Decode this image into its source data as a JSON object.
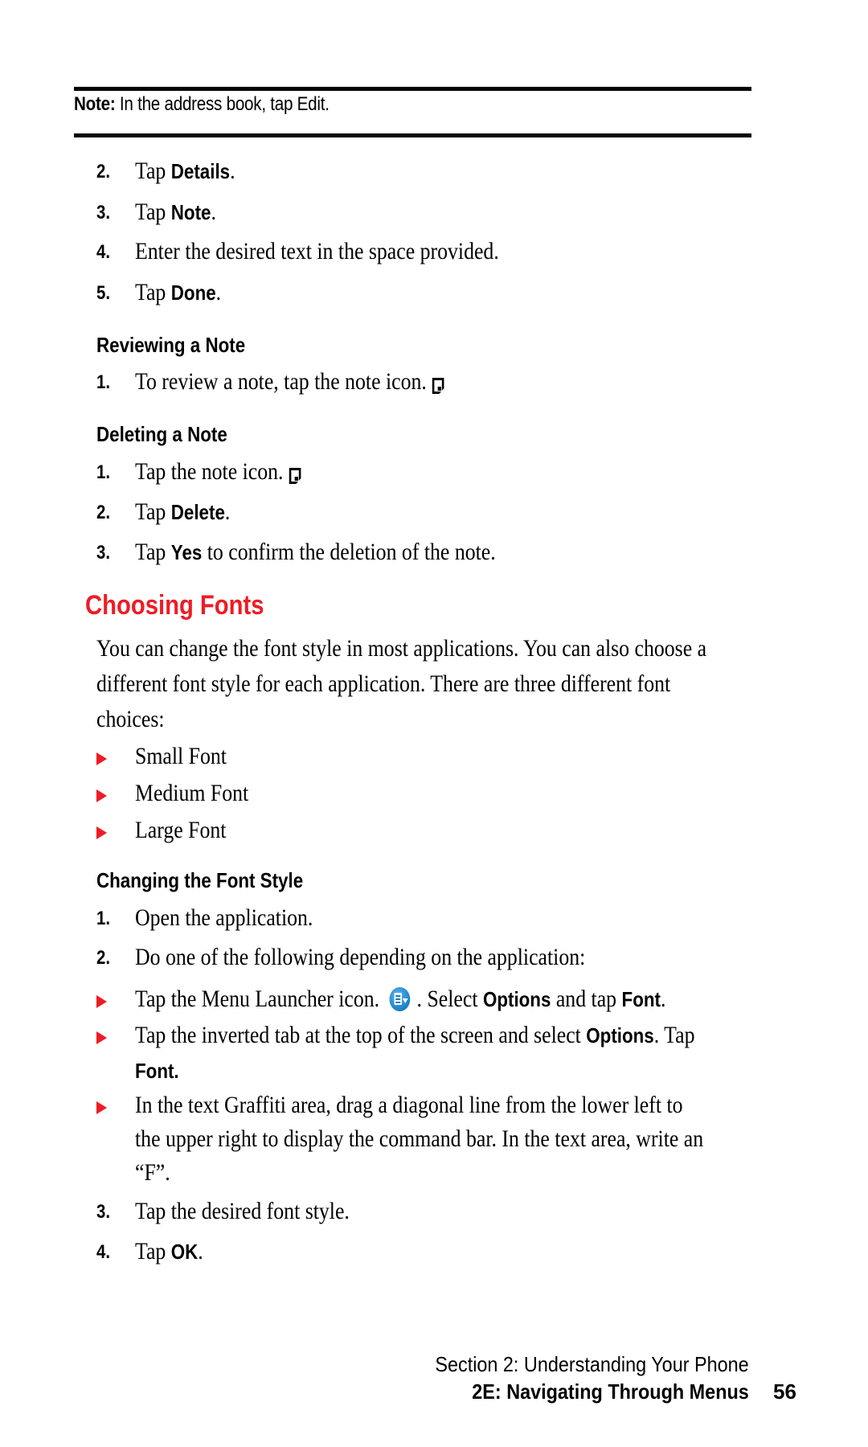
{
  "note_box": {
    "label": "Note:",
    "text": " In the address book, tap Edit."
  },
  "steps_add_note": [
    {
      "num": "2.",
      "pre": "Tap ",
      "bold": "Details",
      "post": "."
    },
    {
      "num": "3.",
      "pre": "Tap ",
      "bold": "Note",
      "post": "."
    },
    {
      "num": "4.",
      "pre": "Enter the desired text in the space provided.",
      "bold": "",
      "post": ""
    },
    {
      "num": "5.",
      "pre": "Tap ",
      "bold": "Done",
      "post": "."
    }
  ],
  "reviewing": {
    "heading": "Reviewing a Note",
    "steps": [
      {
        "num": "1.",
        "text": "To review a note, tap the note icon.",
        "icon": "note-icon"
      }
    ]
  },
  "deleting": {
    "heading": "Deleting a Note",
    "steps": [
      {
        "num": "1.",
        "pre": "Tap the note icon.",
        "bold": "",
        "post": "",
        "icon": "note-icon"
      },
      {
        "num": "2.",
        "pre": "Tap ",
        "bold": "Delete",
        "post": "."
      },
      {
        "num": "3.",
        "pre": "Tap ",
        "bold": "Yes",
        "post": " to confirm the deletion of the note."
      }
    ]
  },
  "choosing_fonts": {
    "title": "Choosing Fonts",
    "paragraph_lines": [
      "You can change the font style in most applications. You can also choose a",
      "different font style for each application. There are three different font",
      "choices:"
    ],
    "choices": [
      "Small Font",
      "Medium Font",
      "Large Font"
    ]
  },
  "changing_style": {
    "heading": "Changing the Font Style",
    "step1": {
      "num": "1.",
      "text": "Open the application."
    },
    "step2": {
      "num": "2.",
      "text": "Do one of the following depending on the application:"
    },
    "option1": {
      "pre": "Tap the Menu Launcher icon.",
      "mid": ". Select ",
      "bold1": "Options",
      "and": " and tap ",
      "bold2": "Font",
      "post": ".",
      "icon": "menu-launcher-icon"
    },
    "option2": {
      "line1_pre": "Tap the inverted tab at the top of the screen and select ",
      "line1_bold": "Options",
      "line1_post": ". Tap",
      "line2_bold": "Font."
    },
    "option3": {
      "lines": [
        "In the text Graffiti area, drag a diagonal line from the lower left to",
        "the upper right to display the command bar. In the text area, write an",
        "“F”."
      ]
    },
    "step3": {
      "num": "3.",
      "text": "Tap the desired font style."
    },
    "step4": {
      "num": "4.",
      "pre": "Tap ",
      "bold": "OK",
      "post": "."
    }
  },
  "footer": {
    "section": "Section 2: Understanding Your Phone",
    "chapter": "2E: Navigating Through Menus",
    "page_number": "56"
  },
  "colors": {
    "accent_red": "#ee1c24",
    "text": "#000000"
  }
}
